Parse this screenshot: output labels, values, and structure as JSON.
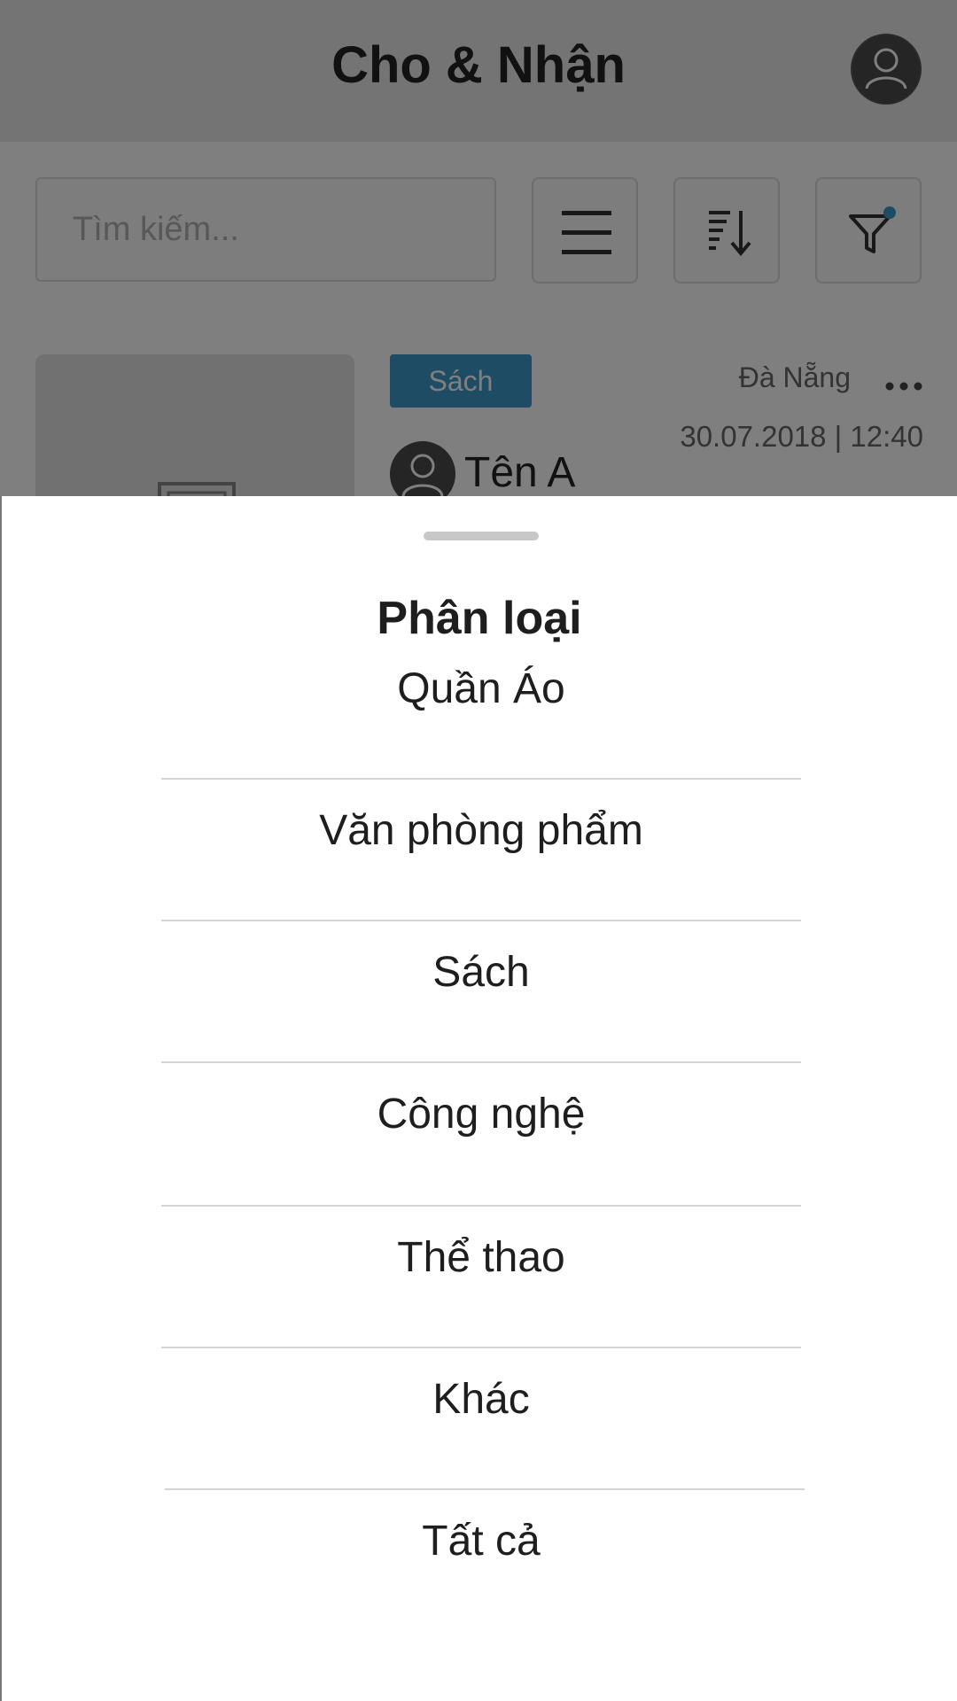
{
  "header": {
    "title": "Cho & Nhận"
  },
  "search": {
    "placeholder": "Tìm kiếm..."
  },
  "toolbar": {
    "icons": [
      "menu-icon",
      "sort-icon",
      "filter-icon"
    ],
    "filter_active": true
  },
  "card": {
    "category": "Sách",
    "location": "Đà Nẵng",
    "date": "30.07.2018 | 12:40",
    "author": "Tên A"
  },
  "sheet": {
    "title": "Phân loại",
    "options": [
      "Quần Áo",
      "Văn phòng phẩm",
      "Sách",
      "Công nghệ",
      "Thể thao",
      "Khác",
      "Tất cả"
    ]
  },
  "colors": {
    "accent": "#3a98c9",
    "overlay": "rgba(0,0,0,0.5)",
    "text": "#1e1e1e"
  }
}
